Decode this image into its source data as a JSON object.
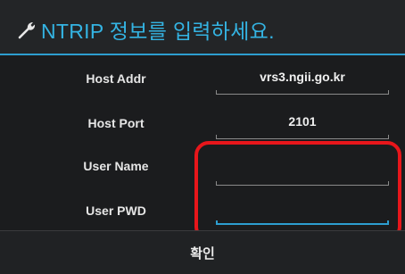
{
  "dialog": {
    "title": "NTRIP 정보를 입력하세요.",
    "title_icon": "wrench-icon",
    "accent_color": "#2d9ed0",
    "title_color": "#34b4e3"
  },
  "fields": [
    {
      "label": "Host Addr",
      "value": "vrs3.ngii.go.kr"
    },
    {
      "label": "Host Port",
      "value": "2101"
    },
    {
      "label": "User Name",
      "value": ""
    },
    {
      "label": "User PWD",
      "value": ""
    }
  ],
  "confirm_button": {
    "label": "확인"
  },
  "annotation": {
    "color": "#e8161b"
  }
}
